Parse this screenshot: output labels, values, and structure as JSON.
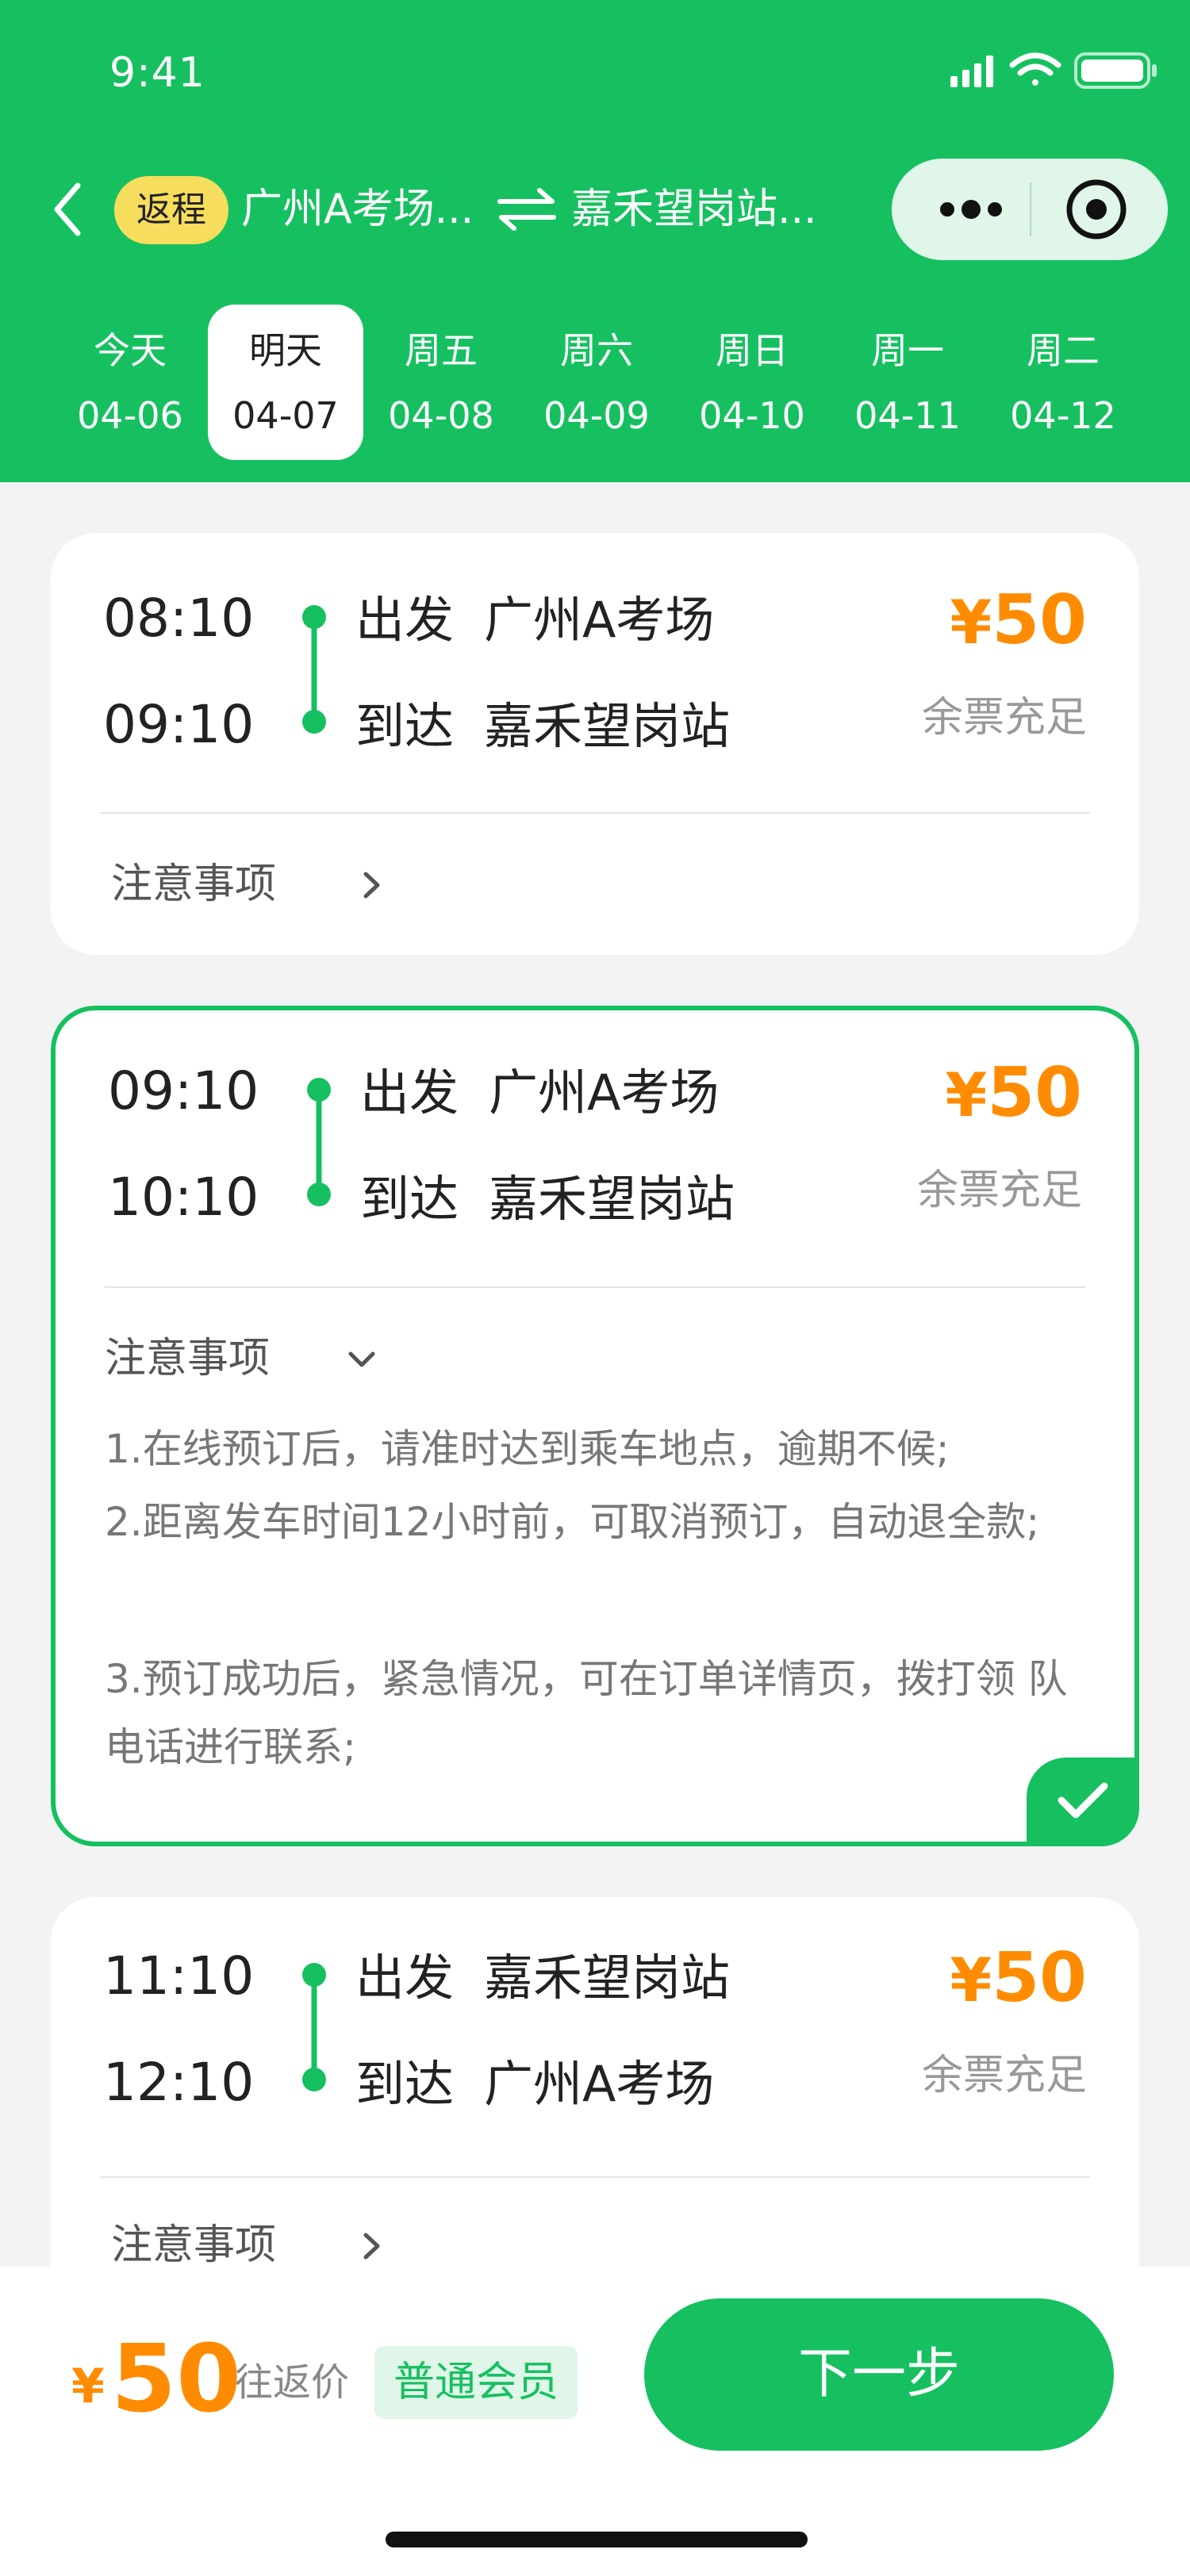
{
  "status_bar": {
    "time": "9:41"
  },
  "header": {
    "trip_type": "返程",
    "from": "广州A考场...",
    "to": "嘉禾望岗站...",
    "colors": {
      "primary": "#16c060",
      "badge": "#f7dd5d",
      "price": "#ff8c00"
    }
  },
  "dates": [
    {
      "day": "今天",
      "date": "04-06",
      "active": false
    },
    {
      "day": "明天",
      "date": "04-07",
      "active": true
    },
    {
      "day": "周五",
      "date": "04-08",
      "active": false
    },
    {
      "day": "周六",
      "date": "04-09",
      "active": false
    },
    {
      "day": "周日",
      "date": "04-10",
      "active": false
    },
    {
      "day": "周一",
      "date": "04-11",
      "active": false
    },
    {
      "day": "周二",
      "date": "04-12",
      "active": false
    }
  ],
  "trips": [
    {
      "depart_time": "08:10",
      "arrive_time": "09:10",
      "depart_label": "出发",
      "arrive_label": "到达",
      "depart_station": "广州A考场",
      "arrive_station": "嘉禾望岗站",
      "currency": "¥",
      "price": "50",
      "availability": "余票充足",
      "notice_label": "注意事项",
      "selected": false
    },
    {
      "depart_time": "09:10",
      "arrive_time": "10:10",
      "depart_label": "出发",
      "arrive_label": "到达",
      "depart_station": "广州A考场",
      "arrive_station": "嘉禾望岗站",
      "currency": "¥",
      "price": "50",
      "availability": "余票充足",
      "notice_label": "注意事项",
      "selected": true,
      "notice_items": [
        "1.在线预订后，请准时达到乘车地点，逾期不候;",
        "2.距离发车时间12小时前，可取消预订，自动退全款;",
        "3.预订成功后，紧急情况，可在订单详情页，拨打领  队电话进行联系;"
      ]
    },
    {
      "depart_time": "11:10",
      "arrive_time": "12:10",
      "depart_label": "出发",
      "arrive_label": "到达",
      "depart_station": "嘉禾望岗站",
      "arrive_station": "广州A考场",
      "currency": "¥",
      "price": "50",
      "availability": "余票充足",
      "notice_label": "注意事项",
      "selected": false
    }
  ],
  "footer": {
    "currency": "¥",
    "total": "50",
    "total_label": "往返价",
    "member_badge": "普通会员",
    "next_button": "下一步"
  }
}
